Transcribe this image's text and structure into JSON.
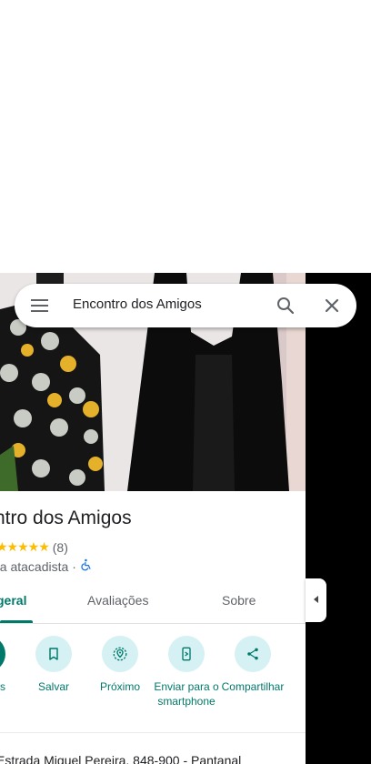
{
  "search": {
    "value": "Encontro dos Amigos"
  },
  "place": {
    "title": "ntro dos Amigos",
    "rating_stars": "★★★★★",
    "review_count": "(8)",
    "category": "ria atacadista",
    "separator": "·"
  },
  "tabs": [
    {
      "label": "geral",
      "active": true
    },
    {
      "label": "Avaliações",
      "active": false
    },
    {
      "label": "Sobre",
      "active": false
    }
  ],
  "actions": [
    {
      "label": "s",
      "icon": "directions-icon"
    },
    {
      "label": "Salvar",
      "icon": "bookmark-icon"
    },
    {
      "label": "Próximo",
      "icon": "nearby-icon"
    },
    {
      "label": "Enviar para o smartphone",
      "icon": "send-to-phone-icon"
    },
    {
      "label": "Compartilhar",
      "icon": "share-icon"
    }
  ],
  "address": "Estrada Miguel Pereira, 848-900 - Pantanal",
  "colors": {
    "accent": "#00796b",
    "action_bg": "#d6f1f4",
    "star": "#fbbc04"
  }
}
